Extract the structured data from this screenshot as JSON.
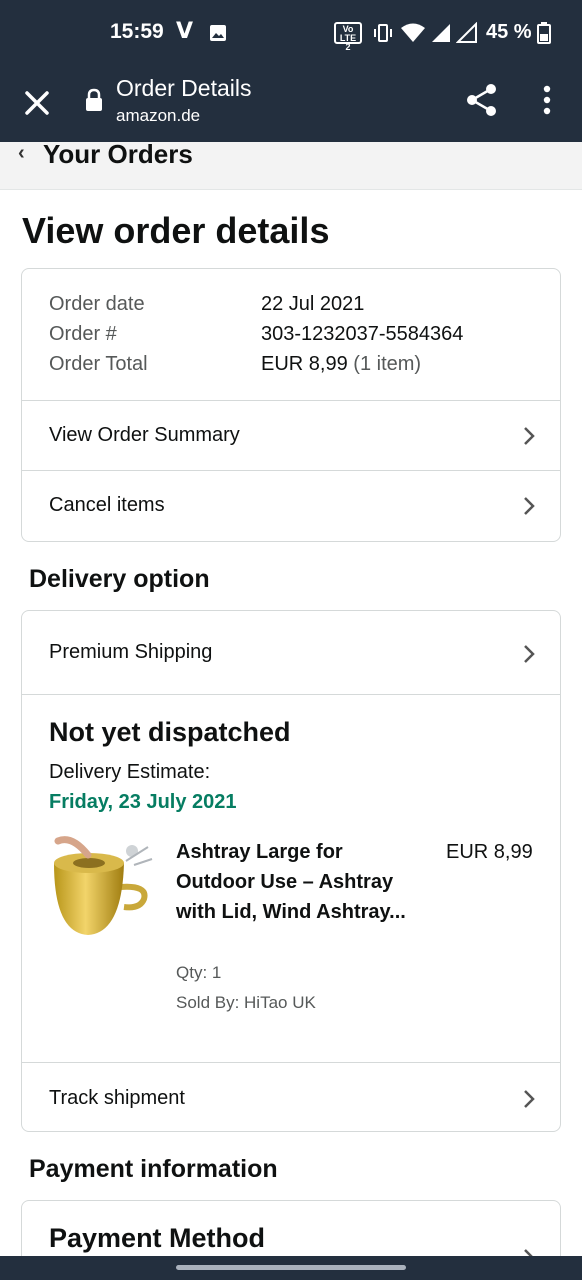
{
  "status_bar": {
    "time": "15:59",
    "carrier_glyph": "V",
    "volte_label": "Vo LTE 2",
    "battery_percent": "45 %"
  },
  "toolbar": {
    "title": "Order Details",
    "domain": "amazon.de"
  },
  "breadcrumb": {
    "label": "Your Orders"
  },
  "page": {
    "title": "View order details"
  },
  "order_info": {
    "rows": [
      {
        "label": "Order date",
        "value": "22 Jul 2021"
      },
      {
        "label": "Order #",
        "value": "303-1232037-5584364"
      },
      {
        "label": "Order Total",
        "value": "EUR 8,99",
        "extra": "(1 item)"
      }
    ],
    "links": [
      {
        "label": "View Order Summary"
      },
      {
        "label": "Cancel items"
      }
    ]
  },
  "delivery": {
    "section_title": "Delivery option",
    "shipping_method": "Premium Shipping",
    "status": "Not yet dispatched",
    "estimate_label": "Delivery Estimate:",
    "estimate_date": "Friday, 23 July 2021",
    "item": {
      "title": "Ashtray Large for Outdoor Use – Ashtray with Lid, Wind Ashtray...",
      "price": "EUR 8,99",
      "qty": "Qty: 1",
      "sold_by": "Sold By: HiTao UK"
    },
    "track_label": "Track shipment"
  },
  "payment": {
    "section_title": "Payment information",
    "method_title": "Payment Method"
  },
  "colors": {
    "header_bg": "#232f3e",
    "estimate_green": "#067d62",
    "border": "#d5d9d9"
  },
  "icons": [
    "close-icon",
    "lock-icon",
    "share-icon",
    "more-vert-icon",
    "chevron-left-icon",
    "chevron-right-icon"
  ]
}
